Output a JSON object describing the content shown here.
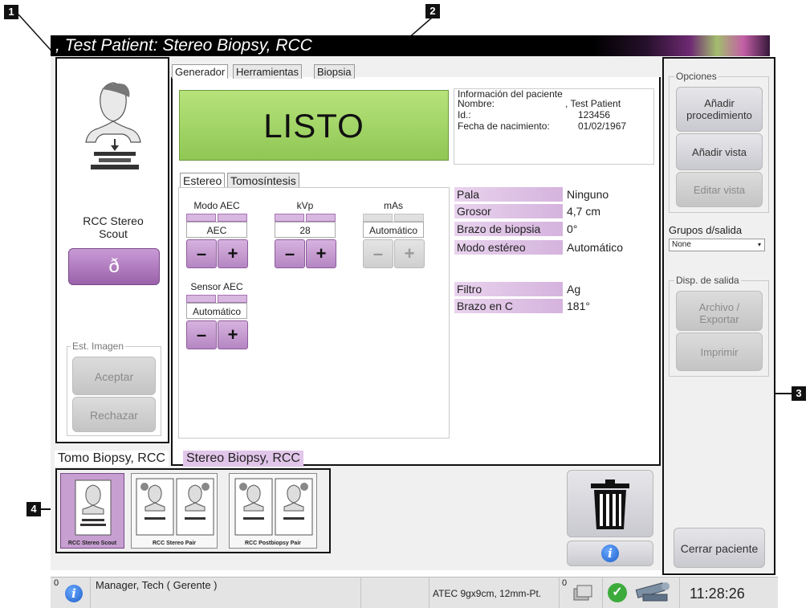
{
  "callouts": [
    "1",
    "2",
    "3",
    "4"
  ],
  "header": {
    "title": ", Test Patient:  Stereo Biopsy, RCC"
  },
  "left_panel": {
    "view_label": "RCC Stereo Scout",
    "view_icon": "breast-compression-figure",
    "expose_button_icon": "flame-icon",
    "image_status": {
      "legend": "Est. Imagen",
      "accept_label": "Aceptar",
      "reject_label": "Rechazar"
    }
  },
  "center": {
    "tabs": [
      "Generador",
      "Herramientas",
      "Biopsia"
    ],
    "active_tab": "Generador",
    "status": "LISTO",
    "status_color": "#9fd15f",
    "patient_info": {
      "heading": "Información del paciente",
      "rows": [
        {
          "label": "Nombre:",
          "value": ", Test Patient"
        },
        {
          "label": "Id.:",
          "value": "123456"
        },
        {
          "label": "Fecha de nacimiento:",
          "value": "01/02/1967"
        }
      ]
    },
    "mode_tabs": [
      "Estereo",
      "Tomosíntesis"
    ],
    "controls": [
      {
        "label": "Modo AEC",
        "value": "AEC",
        "enabled": true
      },
      {
        "label": "kVp",
        "value": "28",
        "enabled": true
      },
      {
        "label": "mAs",
        "value": "Automático",
        "enabled": false
      }
    ],
    "sensor": {
      "label": "Sensor AEC",
      "value": "Automático"
    },
    "minus_symbol": "–",
    "plus_symbol": "+",
    "params": [
      {
        "key": "Pala",
        "value": "Ninguno"
      },
      {
        "key": "Grosor",
        "value": "4,7 cm"
      },
      {
        "key": "Brazo de biopsia",
        "value": "0°"
      },
      {
        "key": "Modo estéreo",
        "value": "Automático"
      },
      {
        "key": "Filtro",
        "value": "Ag"
      },
      {
        "key": "Brazo en C",
        "value": "181°"
      }
    ]
  },
  "right_panel": {
    "options_legend": "Opciones",
    "add_procedure": "Añadir procedimiento",
    "add_view": "Añadir vista",
    "edit_view": "Editar vista",
    "output_groups_label": "Grupos d/salida",
    "output_groups_value": "None",
    "output_devices_legend": "Disp. de salida",
    "archive_export": "Archivo / Exportar",
    "print": "Imprimir",
    "close_patient": "Cerrar paciente"
  },
  "procedures": {
    "tabs": [
      "Tomo Biopsy, RCC",
      "Stereo Biopsy, RCC"
    ],
    "active": "Stereo Biopsy, RCC",
    "thumbnails": [
      {
        "caption": "RCC Stereo Scout",
        "selected": true
      },
      {
        "caption": "RCC Stereo Pair",
        "selected": false
      },
      {
        "caption": "RCC Postbiopsy Pair",
        "selected": false
      }
    ]
  },
  "trash": {
    "icon": "trash-icon",
    "info_icon": "info-icon"
  },
  "statusbar": {
    "alarm_count": "0",
    "user": "Manager, Tech ( Gerente )",
    "device": "ATEC 9gx9cm, 12mm-Pt.",
    "queue_count": "0",
    "time": "11:28:26",
    "accent_green": "#3cab3c",
    "info_blue": "#1d5fc9"
  },
  "colors": {
    "purple_button": "#9a62a9",
    "param_label_bg": "#d5b3dd",
    "ready_green": "#9fd15f"
  }
}
